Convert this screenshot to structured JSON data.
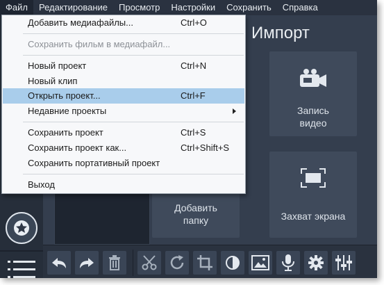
{
  "menubar": {
    "items": [
      "Файл",
      "Редактирование",
      "Просмотр",
      "Настройки",
      "Сохранить",
      "Справка"
    ]
  },
  "main": {
    "title": "Импорт",
    "tiles": {
      "record_video": "Запись\nвидео",
      "add_folder": "Добавить\nпапку",
      "screen_capture": "Захват экрана"
    }
  },
  "file_menu": {
    "add_media": {
      "label": "Добавить медиафайлы...",
      "shortcut": "Ctrl+O"
    },
    "save_movie": {
      "label": "Сохранить фильм в медиафайл..."
    },
    "new_project": {
      "label": "Новый проект",
      "shortcut": "Ctrl+N"
    },
    "new_clip": {
      "label": "Новый клип"
    },
    "open_project": {
      "label": "Открыть проект...",
      "shortcut": "Ctrl+F"
    },
    "recent_projects": {
      "label": "Недавние проекты"
    },
    "save_project": {
      "label": "Сохранить проект",
      "shortcut": "Ctrl+S"
    },
    "save_project_as": {
      "label": "Сохранить проект как...",
      "shortcut": "Ctrl+Shift+S"
    },
    "save_portable": {
      "label": "Сохранить портативный проект"
    },
    "exit": {
      "label": "Выход"
    }
  },
  "toolbar": {
    "icons": [
      "undo-icon",
      "redo-icon",
      "trash-icon",
      "scissors-icon",
      "rotate-icon",
      "crop-icon",
      "color-adjust-icon",
      "image-icon",
      "microphone-icon",
      "gear-icon",
      "equalizer-icon"
    ]
  },
  "colors": {
    "window_bg": "#2f3846",
    "menu_highlight": "#a9cdeb",
    "tile_bg": "#3f4a5b"
  }
}
